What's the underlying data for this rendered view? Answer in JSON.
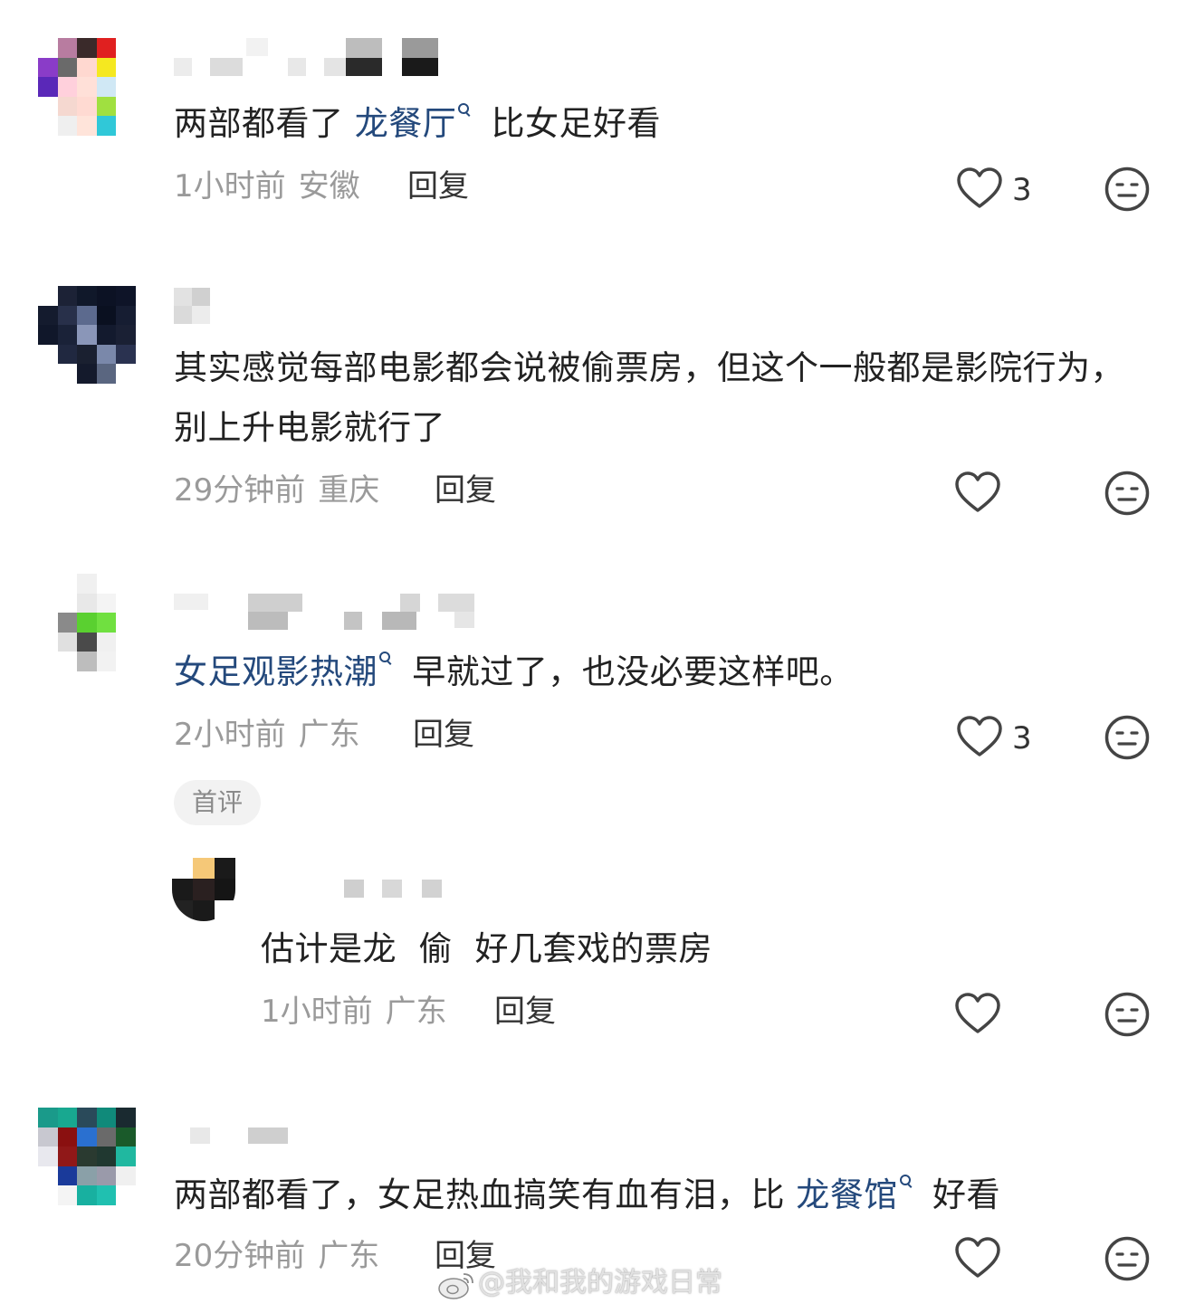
{
  "colors": {
    "tag": "#24497c",
    "meta": "#9a9a9a",
    "reply": "#333333",
    "icon": "#444444"
  },
  "icons": {
    "like": "heart-outline-icon",
    "dislike": "unhappy-face-icon",
    "tag_search": "search-icon"
  },
  "comments": [
    {
      "parts": [
        "两部都看了 ",
        "龙餐厅",
        " 比女足好看"
      ],
      "time": "1小时前",
      "location": "安徽",
      "reply": "回复",
      "likes": "3"
    },
    {
      "parts": [
        "其实感觉每部电影都会说被偷票房，但这个一般都是影院行为，别上升电影就行了"
      ],
      "time": "29分钟前",
      "location": "重庆",
      "reply": "回复",
      "likes": ""
    },
    {
      "parts": [
        "女足观影热潮",
        " 早就过了，也没必要这样吧。"
      ],
      "time": "2小时前",
      "location": "广东",
      "reply": "回复",
      "likes": "3",
      "badge": "首评",
      "sub": {
        "text": "估计是龙  偷  好几套戏的票房",
        "time": "1小时前",
        "location": "广东",
        "reply": "回复",
        "likes": ""
      }
    },
    {
      "parts": [
        "两部都看了，女足热血搞笑有血有泪，比 ",
        "龙餐馆",
        " 好看"
      ],
      "time": "20分钟前",
      "location": "广东",
      "reply": "回复",
      "likes": ""
    }
  ],
  "watermark": "@我和我的游戏日常"
}
